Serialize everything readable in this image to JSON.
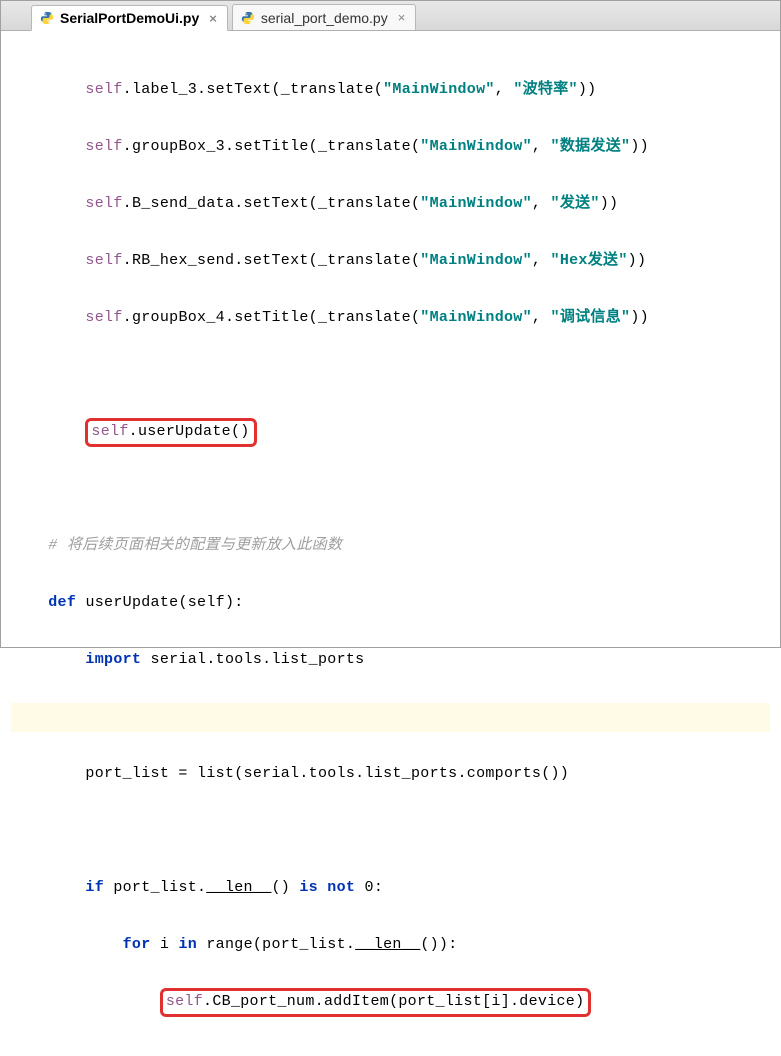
{
  "tabs": [
    {
      "label": "SerialPortDemoUi.py",
      "active": true
    },
    {
      "label": "serial_port_demo.py",
      "active": false
    }
  ],
  "code": {
    "l1a": "self",
    "l1b": ".label_3.setText(_translate(",
    "l1c": "\"MainWindow\"",
    "l1d": ", ",
    "l1e": "\"波特率\"",
    "l1f": "))",
    "l2a": "self",
    "l2b": ".groupBox_3.setTitle(_translate(",
    "l2c": "\"MainWindow\"",
    "l2d": ", ",
    "l2e": "\"数据发送\"",
    "l2f": "))",
    "l3a": "self",
    "l3b": ".B_send_data.setText(_translate(",
    "l3c": "\"MainWindow\"",
    "l3d": ", ",
    "l3e": "\"发送\"",
    "l3f": "))",
    "l4a": "self",
    "l4b": ".RB_hex_send.setText(_translate(",
    "l4c": "\"MainWindow\"",
    "l4d": ", ",
    "l4e": "\"Hex发送\"",
    "l4f": "))",
    "l5a": "self",
    "l5b": ".groupBox_4.setTitle(_translate(",
    "l5c": "\"MainWindow\"",
    "l5d": ", ",
    "l5e": "\"调试信息\"",
    "l5f": "))",
    "rb1a": "self",
    "rb1b": ".userUpdate()",
    "cm1": "# 将后续页面相关的配置与更新放入此函数",
    "def1a": "def ",
    "def1b": "userUpdate",
    "def1c": "(self):",
    "imp1a": "import ",
    "imp1b": "serial.tools.list_ports",
    "pl1": "port_list = list(serial.tools.list_ports.comports())",
    "if1a": "if ",
    "if1b": "port_list.",
    "if1c": "__len__",
    "if1d": "() ",
    "if1e": "is not ",
    "if1f": "0",
    "if1g": ":",
    "for1a": "for ",
    "for1b": "i ",
    "for1c": "in ",
    "for1d": "range(port_list.",
    "for1e": "__len__",
    "for1f": "()):",
    "rb2a": "self",
    "rb2b": ".CB_port_num.addItem(port_list[i].device)"
  }
}
